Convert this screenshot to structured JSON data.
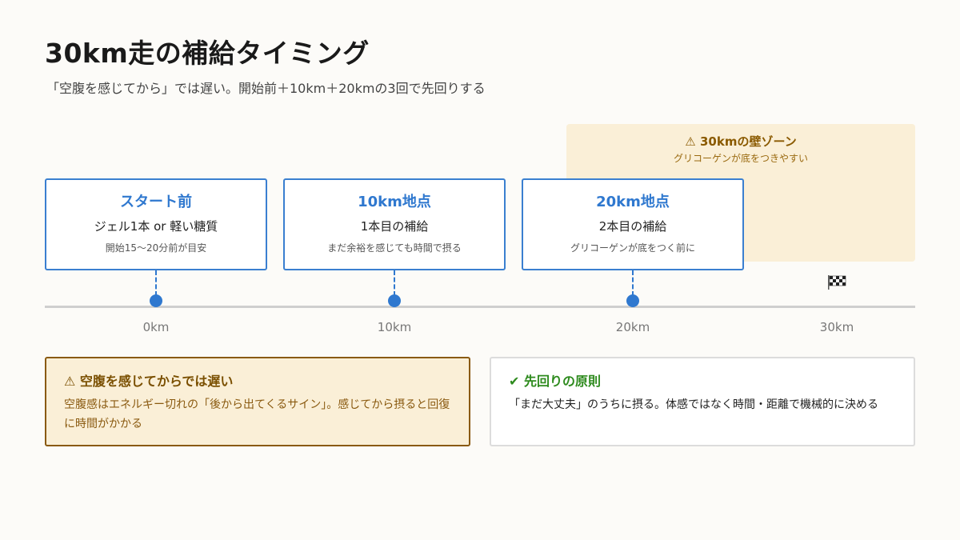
{
  "header": {
    "title": "30km走の補給タイミング",
    "subtitle": "「空腹を感じてから」では遅い。開始前＋10km＋20kmの3回で先回りする"
  },
  "wall_zone": {
    "title": "⚠ 30kmの壁ゾーン",
    "subtitle": "グリコーゲンが底をつきやすい"
  },
  "cards": [
    {
      "title": "スタート前",
      "main": "ジェル1本 or 軽い糖質",
      "note": "開始15〜20分前が目安"
    },
    {
      "title": "10km地点",
      "main": "1本目の補給",
      "note": "まだ余裕を感じても時間で摂る"
    },
    {
      "title": "20km地点",
      "main": "2本目の補給",
      "note": "グリコーゲンが底をつく前に"
    }
  ],
  "axis": {
    "ticks": [
      "0km",
      "10km",
      "20km",
      "30km"
    ],
    "finish_icon": "checkered-flag-icon"
  },
  "warning_box": {
    "title": "⚠ 空腹を感じてからでは遅い",
    "text": "空腹感はエネルギー切れの「後から出てくるサイン」。感じてから摂ると回復に時間がかかる"
  },
  "principle_box": {
    "title": "✔ 先回りの原則",
    "text": "「まだ大丈夫」のうちに摂る。体感ではなく時間・距離で機械的に決める"
  },
  "colors": {
    "accent": "#2f78cf",
    "wall_bg": "#faefd7",
    "warning": "#8a5a10",
    "ok": "#2e8b1e"
  }
}
